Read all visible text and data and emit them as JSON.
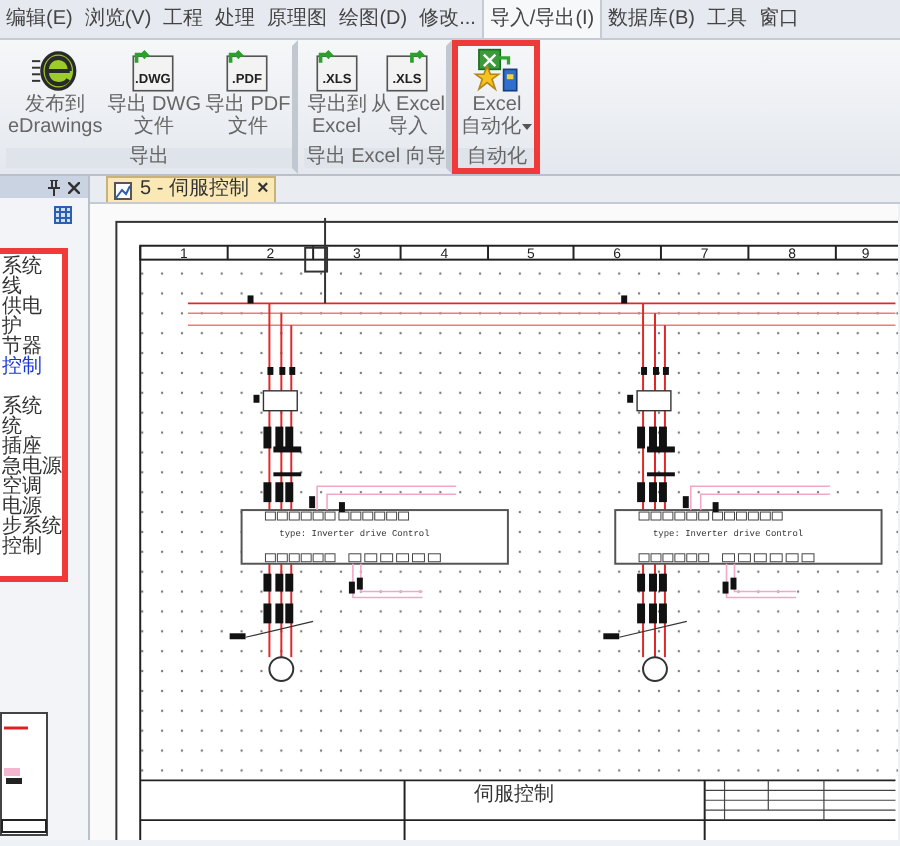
{
  "menu_tabs": [
    {
      "label": "编辑(E)",
      "selected": false
    },
    {
      "label": "浏览(V)",
      "selected": false
    },
    {
      "label": "工程",
      "selected": false
    },
    {
      "label": "处理",
      "selected": false
    },
    {
      "label": "原理图",
      "selected": false
    },
    {
      "label": "绘图(D)",
      "selected": false
    },
    {
      "label": "修改...",
      "selected": false
    },
    {
      "label": "导入/导出(I)",
      "selected": true
    },
    {
      "label": "数据库(B)",
      "selected": false
    },
    {
      "label": "工具",
      "selected": false
    },
    {
      "label": "窗口",
      "selected": false
    }
  ],
  "ribbon": {
    "groups": [
      {
        "label": "导出",
        "highlighted": false,
        "buttons": [
          {
            "kind": "edrawings",
            "lines": [
              "发布到",
              "eDrawings"
            ]
          },
          {
            "kind": "doc-export",
            "icon_text": ".DWG",
            "lines": [
              "导出 DWG",
              "文件"
            ]
          },
          {
            "kind": "doc-export",
            "icon_text": ".PDF",
            "lines": [
              "导出 PDF",
              "文件"
            ]
          }
        ]
      },
      {
        "label": "导出 Excel 向导",
        "highlighted": false,
        "buttons": [
          {
            "kind": "doc-export",
            "icon_text": ".XLS",
            "lines": [
              "导出到",
              "Excel"
            ]
          },
          {
            "kind": "doc-import",
            "icon_text": ".XLS",
            "lines": [
              "从 Excel",
              "导入"
            ]
          }
        ]
      },
      {
        "label": "自动化",
        "highlighted": true,
        "buttons": [
          {
            "kind": "excel-automation",
            "lines": [
              "Excel",
              "自动化"
            ],
            "dropdown": true
          }
        ]
      }
    ]
  },
  "tree": {
    "highlighted": true,
    "groups": [
      {
        "items": [
          {
            "label": "系统",
            "selected": false
          },
          {
            "label": "线",
            "selected": false
          },
          {
            "label": "供电",
            "selected": false
          },
          {
            "label": "护",
            "selected": false
          },
          {
            "label": "节器",
            "selected": false
          },
          {
            "label": "控制",
            "selected": true
          }
        ]
      },
      {
        "items": [
          {
            "label": "系统",
            "selected": false
          },
          {
            "label": "统",
            "selected": false
          },
          {
            "label": "插座",
            "selected": false
          },
          {
            "label": "急电源",
            "selected": false
          },
          {
            "label": "空调",
            "selected": false
          },
          {
            "label": "电源",
            "selected": false
          },
          {
            "label": "步系统",
            "selected": false
          },
          {
            "label": "控制",
            "selected": false
          }
        ]
      }
    ]
  },
  "document_tab": {
    "label": "5 - 伺服控制",
    "close": "×"
  },
  "schematic": {
    "column_numbers": [
      "1",
      "2",
      "3",
      "4",
      "5",
      "6",
      "7",
      "8",
      "9"
    ],
    "modules": [
      {
        "type_label": "type: Inverter drive Control"
      },
      {
        "type_label": "type: Inverter drive Control"
      }
    ],
    "title": "伺服控制"
  }
}
